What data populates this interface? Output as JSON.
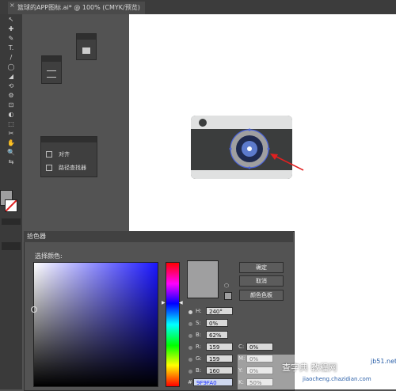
{
  "tab": {
    "title": "篮球的APP图标.ai* @ 100% (CMYK/预览)",
    "close": "×"
  },
  "tools": [
    "↖",
    "✚",
    "✎",
    "T.",
    "/",
    "◯",
    "◢",
    "⟲",
    "⚙",
    "⊡",
    "◐",
    "⬚",
    "✂",
    "✋",
    "🔍",
    "⇆"
  ],
  "panels": {
    "align_label": "对齐",
    "pathfinder_label": "路径查找器"
  },
  "picker": {
    "title": "拾色器",
    "select_label": "选择颜色:",
    "buttons": {
      "ok": "确定",
      "cancel": "取消",
      "swatches": "颜色色板"
    },
    "hsb": [
      {
        "label": "H:",
        "value": "240°"
      },
      {
        "label": "S:",
        "value": "0%"
      },
      {
        "label": "B:",
        "value": "62%"
      }
    ],
    "rgb": [
      {
        "label": "R:",
        "value": "159"
      },
      {
        "label": "G:",
        "value": "159"
      },
      {
        "label": "B:",
        "value": "160"
      }
    ],
    "cmyk": [
      {
        "label": "C:",
        "value": "0%"
      },
      {
        "label": "M:",
        "value": "0%"
      },
      {
        "label": "Y:",
        "value": "0%"
      },
      {
        "label": "K:",
        "value": "50%"
      }
    ],
    "hex_label": "#",
    "hex_value": "9F9FA0",
    "current_color": "#9F9FA0"
  },
  "watermark": {
    "text": "查字典 教程网",
    "url": "jiaocheng.chazidian.com",
    "site": "jb51.net"
  }
}
